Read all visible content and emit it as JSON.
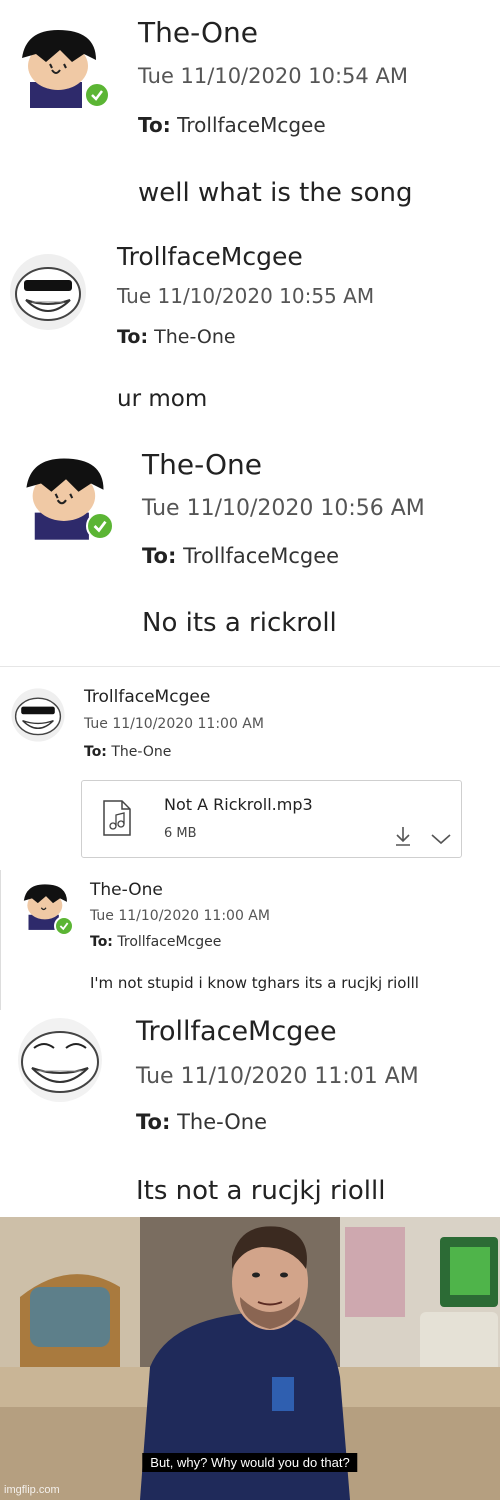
{
  "messages": [
    {
      "sender": "The-One",
      "date": "Tue 11/10/2020 10:54 AM",
      "to_label": "To:",
      "to": "TrollfaceMcgee",
      "body": "well what is the song",
      "avatar": "cartoon-boy-avatar",
      "presence": "available"
    },
    {
      "sender": "TrollfaceMcgee",
      "date": "Tue 11/10/2020 10:55 AM",
      "to_label": "To:",
      "to": "The-One",
      "body": "ur mom",
      "avatar": "trollface-sunglasses-avatar"
    },
    {
      "sender": "The-One",
      "date": "Tue 11/10/2020 10:56 AM",
      "to_label": "To:",
      "to": "TrollfaceMcgee",
      "body": "No its a rickroll",
      "avatar": "cartoon-boy-avatar",
      "presence": "available"
    },
    {
      "sender": "TrollfaceMcgee",
      "date": "Tue 11/10/2020 11:00 AM",
      "to_label": "To:",
      "to": "The-One",
      "avatar": "trollface-sunglasses-avatar",
      "attachment": {
        "filename": "Not A Rickroll.mp3",
        "size": "6 MB",
        "icon": "audio-file-icon"
      }
    },
    {
      "sender": "The-One",
      "date": "Tue 11/10/2020 11:00 AM",
      "to_label": "To:",
      "to": "TrollfaceMcgee",
      "body": "I'm not stupid i know tghars its a rucjkj riolll",
      "avatar": "cartoon-boy-avatar",
      "presence": "available"
    },
    {
      "sender": "TrollfaceMcgee",
      "date": "Tue 11/10/2020 11:01 AM",
      "to_label": "To:",
      "to": "The-One",
      "body": "Its not a rucjkj riolll",
      "avatar": "trollface-avatar"
    }
  ],
  "meme": {
    "caption": "But, why? Why would you do that?",
    "watermark": "imgflip.com"
  },
  "colors": {
    "presence_green": "#5bb534",
    "text": "#222222",
    "meta": "#555555"
  }
}
